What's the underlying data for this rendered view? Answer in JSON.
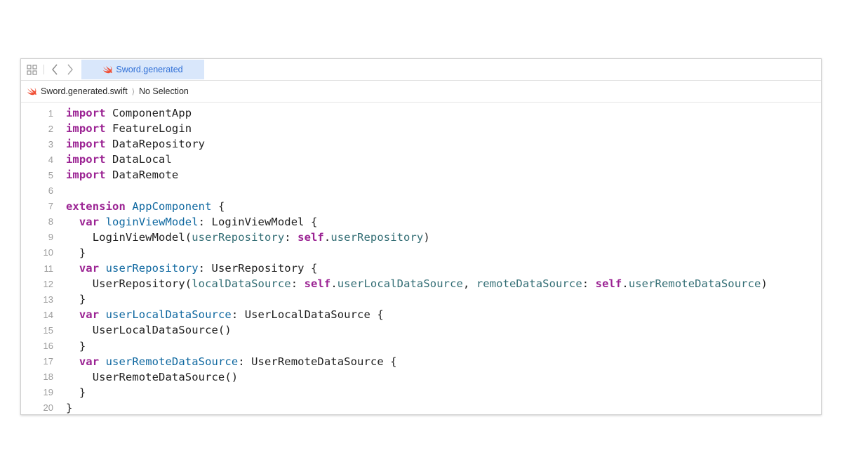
{
  "tab": {
    "label": "Sword.generated"
  },
  "jumpbar": {
    "file": "Sword.generated.swift",
    "separator": "⟩",
    "selection": "No Selection"
  },
  "colors": {
    "keyword": "#9b2393",
    "type": "#1c464a",
    "property": "#326d74",
    "declaration": "#0f68a0",
    "tab_background": "#d9e7fb",
    "tab_text": "#2f6fd6",
    "swift_icon": "#f05138"
  },
  "icons": [
    "grid-icon",
    "chevron-left-icon",
    "chevron-right-icon",
    "swift-icon"
  ],
  "code_lines": [
    {
      "n": "1",
      "tokens": [
        [
          "kw",
          "import"
        ],
        [
          "plain",
          " ComponentApp"
        ]
      ]
    },
    {
      "n": "2",
      "tokens": [
        [
          "kw",
          "import"
        ],
        [
          "plain",
          " FeatureLogin"
        ]
      ]
    },
    {
      "n": "3",
      "tokens": [
        [
          "kw",
          "import"
        ],
        [
          "plain",
          " DataRepository"
        ]
      ]
    },
    {
      "n": "4",
      "tokens": [
        [
          "kw",
          "import"
        ],
        [
          "plain",
          " DataLocal"
        ]
      ]
    },
    {
      "n": "5",
      "tokens": [
        [
          "kw",
          "import"
        ],
        [
          "plain",
          " DataRemote"
        ]
      ]
    },
    {
      "n": "6",
      "tokens": []
    },
    {
      "n": "7",
      "tokens": [
        [
          "kw",
          "extension"
        ],
        [
          "plain",
          " "
        ],
        [
          "decl",
          "AppComponent"
        ],
        [
          "plain",
          " {"
        ]
      ]
    },
    {
      "n": "8",
      "tokens": [
        [
          "plain",
          "  "
        ],
        [
          "kw",
          "var"
        ],
        [
          "plain",
          " "
        ],
        [
          "decl",
          "loginViewModel"
        ],
        [
          "plain",
          ": LoginViewModel {"
        ]
      ]
    },
    {
      "n": "9",
      "tokens": [
        [
          "plain",
          "    LoginViewModel("
        ],
        [
          "prop",
          "userRepository"
        ],
        [
          "plain",
          ": "
        ],
        [
          "kw",
          "self"
        ],
        [
          "plain",
          "."
        ],
        [
          "prop",
          "userRepository"
        ],
        [
          "plain",
          ")"
        ]
      ]
    },
    {
      "n": "10",
      "tokens": [
        [
          "plain",
          "  }"
        ]
      ]
    },
    {
      "n": "11",
      "tokens": [
        [
          "plain",
          "  "
        ],
        [
          "kw",
          "var"
        ],
        [
          "plain",
          " "
        ],
        [
          "decl",
          "userRepository"
        ],
        [
          "plain",
          ": UserRepository {"
        ]
      ]
    },
    {
      "n": "12",
      "tokens": [
        [
          "plain",
          "    UserRepository("
        ],
        [
          "prop",
          "localDataSource"
        ],
        [
          "plain",
          ": "
        ],
        [
          "kw",
          "self"
        ],
        [
          "plain",
          "."
        ],
        [
          "prop",
          "userLocalDataSource"
        ],
        [
          "plain",
          ", "
        ],
        [
          "prop",
          "remoteDataSource"
        ],
        [
          "plain",
          ": "
        ],
        [
          "kw",
          "self"
        ],
        [
          "plain",
          "."
        ],
        [
          "prop",
          "userRemoteDataSource"
        ],
        [
          "plain",
          ")"
        ]
      ]
    },
    {
      "n": "13",
      "tokens": [
        [
          "plain",
          "  }"
        ]
      ]
    },
    {
      "n": "14",
      "tokens": [
        [
          "plain",
          "  "
        ],
        [
          "kw",
          "var"
        ],
        [
          "plain",
          " "
        ],
        [
          "decl",
          "userLocalDataSource"
        ],
        [
          "plain",
          ": UserLocalDataSource {"
        ]
      ]
    },
    {
      "n": "15",
      "tokens": [
        [
          "plain",
          "    UserLocalDataSource()"
        ]
      ]
    },
    {
      "n": "16",
      "tokens": [
        [
          "plain",
          "  }"
        ]
      ]
    },
    {
      "n": "17",
      "tokens": [
        [
          "plain",
          "  "
        ],
        [
          "kw",
          "var"
        ],
        [
          "plain",
          " "
        ],
        [
          "decl",
          "userRemoteDataSource"
        ],
        [
          "plain",
          ": UserRemoteDataSource {"
        ]
      ]
    },
    {
      "n": "18",
      "tokens": [
        [
          "plain",
          "    UserRemoteDataSource()"
        ]
      ]
    },
    {
      "n": "19",
      "tokens": [
        [
          "plain",
          "  }"
        ]
      ]
    },
    {
      "n": "20",
      "tokens": [
        [
          "plain",
          "}"
        ]
      ]
    }
  ]
}
